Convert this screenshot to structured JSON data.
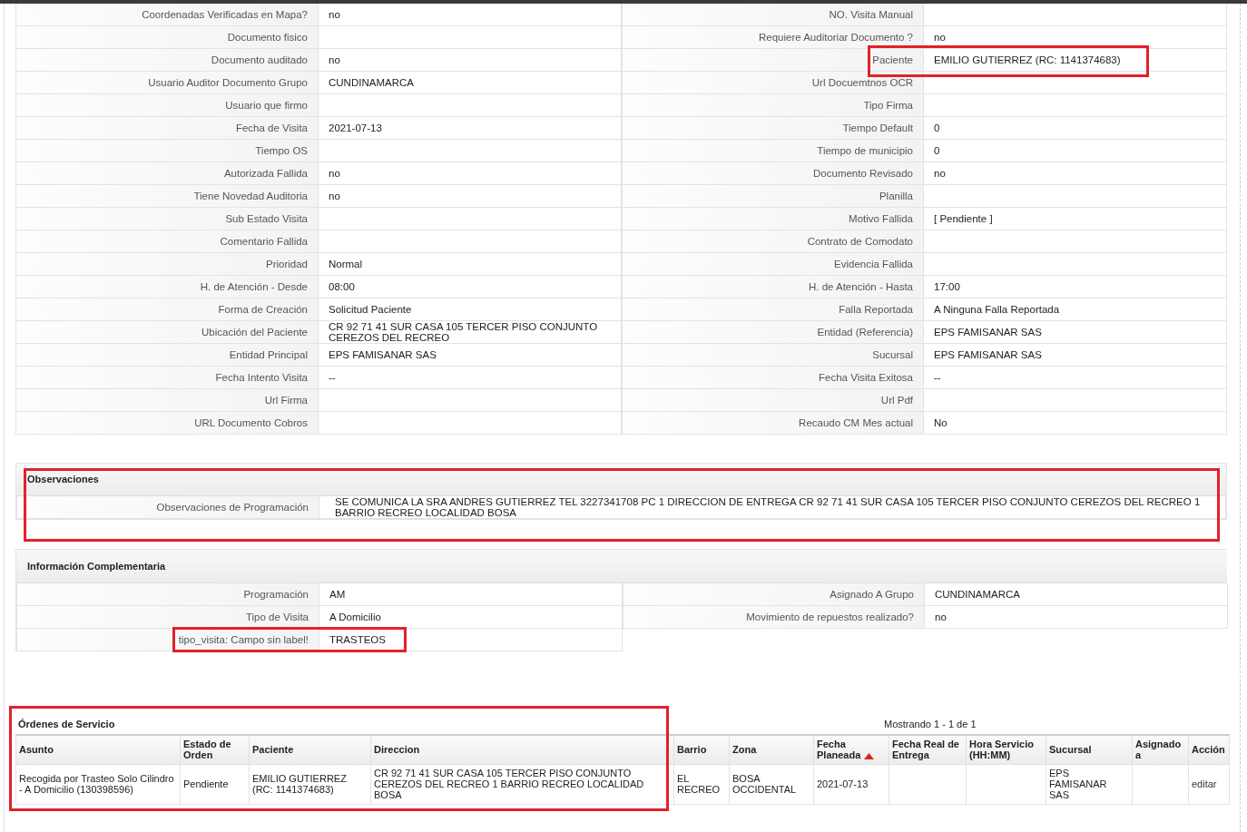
{
  "detail_rows": [
    {
      "left": {
        "label": "Coordenadas Verificadas en Mapa?",
        "value": "no",
        "highlighted": false
      },
      "right": {
        "label": "NO. Visita Manual",
        "highlighted": false
      }
    },
    {
      "left": {
        "label": "Documento fisico",
        "highlighted": false
      },
      "right": {
        "label": "Requiere Auditoriar Documento ?",
        "value": "no",
        "highlighted": false
      }
    },
    {
      "left": {
        "label": "Documento auditado",
        "value": "no",
        "highlighted": false
      },
      "right": {
        "label": "Paciente",
        "value": "EMILIO GUTIERREZ (RC: 1141374683)",
        "highlighted": true
      }
    },
    {
      "left": {
        "label": "Usuario Auditor Documento Grupo",
        "value": "CUNDINAMARCA",
        "highlighted": false
      },
      "right": {
        "label": "Url Docuemtnos OCR",
        "highlighted": false
      }
    },
    {
      "left": {
        "label": "Usuario que firmo",
        "highlighted": false
      },
      "right": {
        "label": "Tipo Firma",
        "highlighted": false
      }
    },
    {
      "left": {
        "label": "Fecha de Visita",
        "value": "2021-07-13",
        "highlighted": false
      },
      "right": {
        "label": "Tiempo Default",
        "value": "0",
        "highlighted": false
      }
    },
    {
      "left": {
        "label": "Tiempo OS",
        "highlighted": false
      },
      "right": {
        "label": "Tiempo de municipio",
        "value": "0",
        "highlighted": false
      }
    },
    {
      "left": {
        "label": "Autorizada Fallida",
        "value": "no",
        "highlighted": false
      },
      "right": {
        "label": "Documento Revisado",
        "value": "no",
        "highlighted": false
      }
    },
    {
      "left": {
        "label": "Tiene Novedad Auditoria",
        "value": "no",
        "highlighted": false
      },
      "right": {
        "label": "Planilla",
        "highlighted": false
      }
    },
    {
      "left": {
        "label": "Sub Estado Visita",
        "highlighted": false
      },
      "right": {
        "label": "Motivo Fallida",
        "value": "[ Pendiente ]",
        "highlighted": false
      }
    },
    {
      "left": {
        "label": "Comentario Fallida",
        "highlighted": false
      },
      "right": {
        "label": "Contrato de Comodato",
        "highlighted": false
      }
    },
    {
      "left": {
        "label": "Prioridad",
        "value": "Normal",
        "highlighted": false
      },
      "right": {
        "label": "Evidencia Fallida",
        "highlighted": false
      }
    },
    {
      "left": {
        "label": "H. de Atención - Desde",
        "value": "08:00",
        "highlighted": false
      },
      "right": {
        "label": "H. de Atención - Hasta",
        "value": "17:00",
        "highlighted": false
      }
    },
    {
      "left": {
        "label": "Forma de Creación",
        "value": "Solicitud Paciente",
        "highlighted": false
      },
      "right": {
        "label": "Falla Reportada",
        "value": "A Ninguna Falla Reportada",
        "highlighted": false
      }
    },
    {
      "left": {
        "label": "Ubicación del Paciente",
        "value": "CR 92 71 41 SUR CASA 105 TERCER PISO CONJUNTO CEREZOS DEL RECREO",
        "highlighted": false
      },
      "right": {
        "label": "Entidad (Referencia)",
        "value": "EPS FAMISANAR SAS",
        "highlighted": false
      }
    },
    {
      "left": {
        "label": "Entidad Principal",
        "value": "EPS FAMISANAR SAS",
        "highlighted": false
      },
      "right": {
        "label": "Sucursal",
        "value": "EPS FAMISANAR SAS",
        "highlighted": false
      }
    },
    {
      "left": {
        "label": "Fecha Intento Visita",
        "value": "--",
        "highlighted": false
      },
      "right": {
        "label": "Fecha Visita Exitosa",
        "value": "--",
        "highlighted": false
      }
    },
    {
      "left": {
        "label": "Url Firma",
        "highlighted": false
      },
      "right": {
        "label": "Url Pdf",
        "highlighted": false
      }
    },
    {
      "left": {
        "label": "URL Documento Cobros",
        "highlighted": false
      },
      "right": {
        "label": "Recaudo CM Mes actual",
        "value": "No",
        "highlighted": false
      }
    }
  ],
  "observaciones": {
    "title": "Observaciones",
    "highlighted": true,
    "rows": [
      {
        "label": "Observaciones de Programación",
        "value": "SE COMUNICA LA SRA ANDRES GUTIERREZ TEL 3227341708 PC 1 DIRECCION DE ENTREGA CR 92 71 41 SUR CASA 105 TERCER PISO CONJUNTO CEREZOS DEL RECREO 1 BARRIO RECREO LOCALIDAD BOSA"
      }
    ]
  },
  "informacion_complementaria": {
    "title": "Información Complementaria",
    "rows": [
      {
        "left": {
          "label": "Programación",
          "value": "AM",
          "highlighted": false
        },
        "right": {
          "label": "Asignado A Grupo",
          "value": "CUNDINAMARCA",
          "highlighted": false
        }
      },
      {
        "left": {
          "label": "Tipo de Visita",
          "value": "A Domicilio",
          "highlighted": false
        },
        "right": {
          "label": "Movimiento de repuestos realizado?",
          "value": "no",
          "highlighted": false
        }
      },
      {
        "left": {
          "label": "tipo_visita: Campo sin label!",
          "value": "TRASTEOS",
          "highlighted": true
        }
      }
    ]
  },
  "ordenes_servicio": {
    "title": "Órdenes de Servicio",
    "highlighted": true,
    "pagination": "Mostrando 1 - 1 de 1",
    "columns": [
      {
        "label": "Asunto",
        "sorted": false
      },
      {
        "label": "Estado de Orden",
        "sorted": false
      },
      {
        "label": "Paciente",
        "sorted": false
      },
      {
        "label": "Direccion",
        "sorted": false
      },
      {
        "label": "Barrio",
        "sorted": false
      },
      {
        "label": "Zona",
        "sorted": false
      },
      {
        "label": "Fecha Planeada",
        "sorted": true
      },
      {
        "label": "Fecha Real de Entrega",
        "sorted": false
      },
      {
        "label": "Hora Servicio (HH:MM)",
        "sorted": false
      },
      {
        "label": "Sucursal",
        "sorted": false
      },
      {
        "label": "Asignado a",
        "sorted": false
      },
      {
        "label": "Acción",
        "sorted": false
      }
    ],
    "rows": [
      {
        "cells": [
          {
            "kind": "text",
            "text": "Recogida por Trasteo Solo Cilindro - A Domicilio (130398596)"
          },
          {
            "kind": "text",
            "text": "Pendiente"
          },
          {
            "kind": "text",
            "text": "EMILIO GUTIERREZ (RC: 1141374683)"
          },
          {
            "kind": "text",
            "text": "CR 92 71 41 SUR CASA 105 TERCER PISO CONJUNTO CEREZOS DEL RECREO 1 BARRIO RECREO LOCALIDAD BOSA"
          },
          {
            "kind": "text",
            "text": "EL RECREO"
          },
          {
            "kind": "text",
            "text": "BOSA OCCIDENTAL"
          },
          {
            "kind": "text",
            "text": "2021-07-13"
          },
          {
            "kind": "empty"
          },
          {
            "kind": "empty"
          },
          {
            "kind": "text",
            "text": "EPS FAMISANAR SAS"
          },
          {
            "kind": "empty"
          },
          {
            "kind": "link",
            "text": "editar"
          }
        ]
      }
    ]
  }
}
